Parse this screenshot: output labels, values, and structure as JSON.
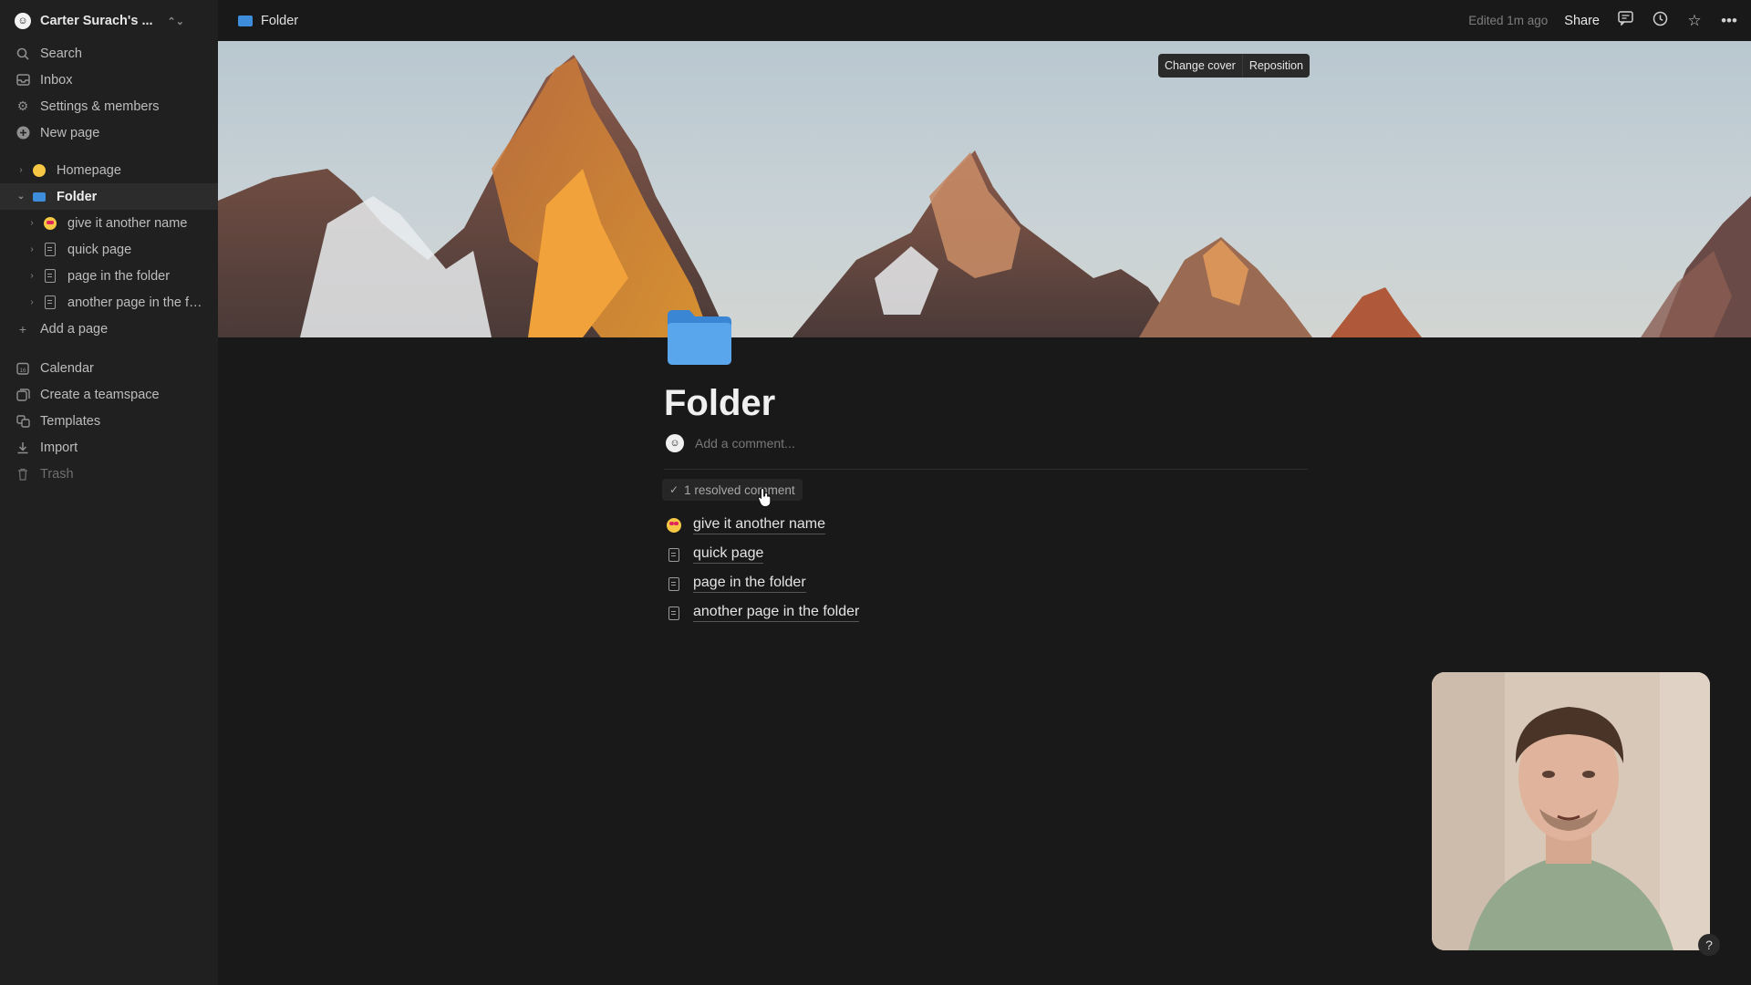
{
  "sidebar": {
    "workspace": {
      "name": "Carter Surach's ...",
      "avatar_glyph": "☺"
    },
    "top_items": [
      {
        "label": "Search",
        "icon": "search-icon"
      },
      {
        "label": "Inbox",
        "icon": "inbox-icon"
      },
      {
        "label": "Settings & members",
        "icon": "gear-icon"
      },
      {
        "label": "New page",
        "icon": "plus-circle-icon"
      }
    ],
    "pages": {
      "homepage": {
        "label": "Homepage"
      },
      "folder": {
        "label": "Folder"
      },
      "children": [
        {
          "label": "give it another name"
        },
        {
          "label": "quick page"
        },
        {
          "label": "page in the folder"
        },
        {
          "label": "another page in the fol..."
        }
      ],
      "add_page": "Add a page"
    },
    "bottom_items": [
      {
        "label": "Calendar",
        "icon": "calendar-icon"
      },
      {
        "label": "Create a teamspace",
        "icon": "teamspace-icon"
      },
      {
        "label": "Templates",
        "icon": "templates-icon"
      },
      {
        "label": "Import",
        "icon": "import-icon"
      },
      {
        "label": "Trash",
        "icon": "trash-icon"
      }
    ]
  },
  "topbar": {
    "breadcrumb": "Folder",
    "edited": "Edited 1m ago",
    "share": "Share"
  },
  "cover": {
    "change_cover": "Change cover",
    "reposition": "Reposition"
  },
  "page": {
    "title": "Folder",
    "comment_placeholder": "Add a comment...",
    "resolved": "1 resolved comment",
    "subpages": [
      {
        "label": "give it another name",
        "icon": "heart-eyes-emoji-icon"
      },
      {
        "label": "quick page",
        "icon": "document-icon"
      },
      {
        "label": "page in the folder",
        "icon": "document-icon"
      },
      {
        "label": "another page in the folder",
        "icon": "document-icon"
      }
    ]
  },
  "help": "?",
  "colors": {
    "accent_folder": "#3e8ddb",
    "background": "#191919",
    "sidebar": "#202020"
  }
}
